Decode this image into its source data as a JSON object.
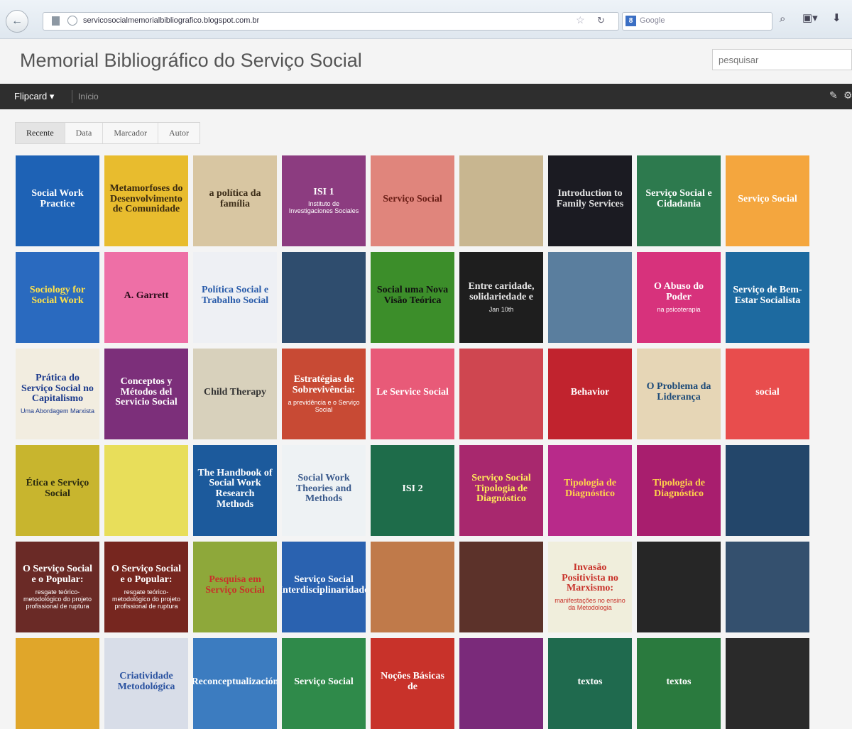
{
  "browser": {
    "url": "servicosocialmemorialbibliografico.blogspot.com.br",
    "search_engine_placeholder": "Google"
  },
  "header": {
    "title": "Memorial Bibliográfico do Serviço Social",
    "search_placeholder": "pesquisar"
  },
  "nav": {
    "view_label": "Flipcard ▾",
    "home_label": "Início"
  },
  "tabs": [
    "Recente",
    "Data",
    "Marcador",
    "Autor"
  ],
  "active_tab": "Recente",
  "posts": [
    {
      "title": "Social Work Practice",
      "subtitle": "",
      "bg": "#1e62b5",
      "fg": "#ffffff"
    },
    {
      "title": "Metamorfoses do Desenvolvimento de Comunidade",
      "subtitle": "",
      "bg": "#e8bc2e",
      "fg": "#3a2a10"
    },
    {
      "title": "a política da família",
      "subtitle": "",
      "bg": "#d8c6a2",
      "fg": "#3b2c17"
    },
    {
      "title": "ISI 1",
      "subtitle": "Instituto de Investigaciones Sociales",
      "bg": "#8c3c80",
      "fg": "#ffffff"
    },
    {
      "title": "Serviço Social",
      "subtitle": "",
      "bg": "#e0857c",
      "fg": "#6a1e16"
    },
    {
      "title": "",
      "subtitle": "",
      "bg": "#c8b690",
      "fg": "#2c2418"
    },
    {
      "title": "Introduction to Family Services",
      "subtitle": "",
      "bg": "#1b1b22",
      "fg": "#e0e0e0"
    },
    {
      "title": "Serviço Social e Cidadania",
      "subtitle": "",
      "bg": "#2d7a4e",
      "fg": "#ffffff"
    },
    {
      "title": "Serviço Social",
      "subtitle": "",
      "bg": "#f4a63e",
      "fg": "#ffffff"
    },
    {
      "title": "Sociology for Social Work",
      "subtitle": "",
      "bg": "#2a6abf",
      "fg": "#ffe24a"
    },
    {
      "title": "A. Garrett",
      "subtitle": "",
      "bg": "#ee6fa6",
      "fg": "#2a0d1a"
    },
    {
      "title": "Política Social e Trabalho Social",
      "subtitle": "",
      "bg": "#eef0f4",
      "fg": "#2a5caa"
    },
    {
      "title": "",
      "subtitle": "",
      "bg": "#2f4d6e",
      "fg": "#ffffff"
    },
    {
      "title": "Social uma Nova Visão Teórica",
      "subtitle": "",
      "bg": "#3c8e2a",
      "fg": "#111111"
    },
    {
      "title": "Entre caridade, solidariedade e",
      "subtitle": "Jan 10th",
      "bg": "#1e1e1e",
      "fg": "#e8e8e8"
    },
    {
      "title": "",
      "subtitle": "",
      "bg": "#5a7e9e",
      "fg": "#ffffff"
    },
    {
      "title": "O Abuso do Poder",
      "subtitle": "na psicoterapia",
      "bg": "#d7327c",
      "fg": "#ffffff"
    },
    {
      "title": "Serviço de Bem-Estar Socialista",
      "subtitle": "",
      "bg": "#1d6aa0",
      "fg": "#ffffff"
    },
    {
      "title": "Prática do Serviço Social no Capitalismo",
      "subtitle": "Uma Abordagem Marxista",
      "bg": "#f2ede0",
      "fg": "#1c3a8c"
    },
    {
      "title": "Conceptos y Métodos del Servicio Social",
      "subtitle": "",
      "bg": "#7c2f7a",
      "fg": "#ffffff"
    },
    {
      "title": "Child Therapy",
      "subtitle": "",
      "bg": "#d8d1bc",
      "fg": "#333333"
    },
    {
      "title": "Estratégias de Sobrevivência:",
      "subtitle": "a previdência e o Serviço Social",
      "bg": "#c84a34",
      "fg": "#ffffff"
    },
    {
      "title": "Le Service Social",
      "subtitle": "",
      "bg": "#e85a78",
      "fg": "#ffffff"
    },
    {
      "title": "",
      "subtitle": "",
      "bg": "#cf4650",
      "fg": "#ffffff"
    },
    {
      "title": "Behavior",
      "subtitle": "",
      "bg": "#c1232e",
      "fg": "#ffffff"
    },
    {
      "title": "O Problema da Liderança",
      "subtitle": "",
      "bg": "#e6d6b6",
      "fg": "#1c4a78"
    },
    {
      "title": "social",
      "subtitle": "",
      "bg": "#e84d4d",
      "fg": "#ffffff"
    },
    {
      "title": "Ética e Serviço Social",
      "subtitle": "",
      "bg": "#c8b52e",
      "fg": "#2a2a10"
    },
    {
      "title": "",
      "subtitle": "",
      "bg": "#e8de5a",
      "fg": "#2a3a10"
    },
    {
      "title": "The Handbook of Social Work Research Methods",
      "subtitle": "",
      "bg": "#1c5a9c",
      "fg": "#ffffff"
    },
    {
      "title": "Social Work Theories and Methods",
      "subtitle": "",
      "bg": "#eef2f4",
      "fg": "#3a5a8c"
    },
    {
      "title": "ISI 2",
      "subtitle": "",
      "bg": "#1e6c4a",
      "fg": "#ffffff"
    },
    {
      "title": "Serviço Social Tipologia de Diagnóstico",
      "subtitle": "",
      "bg": "#a8286e",
      "fg": "#ffe95a"
    },
    {
      "title": "Tipologia de Diagnóstico",
      "subtitle": "",
      "bg": "#b82a8a",
      "fg": "#ffd34a"
    },
    {
      "title": "Tipologia de Diagnóstico",
      "subtitle": "",
      "bg": "#a81e6e",
      "fg": "#ffd34a"
    },
    {
      "title": "",
      "subtitle": "",
      "bg": "#23466a",
      "fg": "#ffffff"
    },
    {
      "title": "O Serviço Social e o Popular:",
      "subtitle": "resgate teórico-metodológico do projeto profissional de ruptura",
      "bg": "#6a2a26",
      "fg": "#ffffff"
    },
    {
      "title": "O Serviço Social e o Popular:",
      "subtitle": "resgate teórico-metodológico do projeto profissional de ruptura",
      "bg": "#76261f",
      "fg": "#ffffff"
    },
    {
      "title": "Pesquisa em Serviço Social",
      "subtitle": "",
      "bg": "#8ea83a",
      "fg": "#c8322a"
    },
    {
      "title": "Serviço Social Interdisciplinaridade",
      "subtitle": "",
      "bg": "#2a62b0",
      "fg": "#ffffff"
    },
    {
      "title": "",
      "subtitle": "",
      "bg": "#c07a4a",
      "fg": "#ffffff"
    },
    {
      "title": "",
      "subtitle": "",
      "bg": "#5c322a",
      "fg": "#ffffff"
    },
    {
      "title": "Invasão Positivista no Marxismo:",
      "subtitle": "manifestações no ensino da Metodologia",
      "bg": "#f0eedc",
      "fg": "#c8322a"
    },
    {
      "title": "",
      "subtitle": "",
      "bg": "#262626",
      "fg": "#ffffff"
    },
    {
      "title": "",
      "subtitle": "",
      "bg": "#34506e",
      "fg": "#ffffff"
    },
    {
      "title": "",
      "subtitle": "",
      "bg": "#e0a62a",
      "fg": "#3a2a10"
    },
    {
      "title": "Criatividade Metodológica",
      "subtitle": "",
      "bg": "#d8dde8",
      "fg": "#2a52a0"
    },
    {
      "title": "Reconceptualización",
      "subtitle": "",
      "bg": "#3c7cc0",
      "fg": "#ffffff"
    },
    {
      "title": "Serviço Social",
      "subtitle": "",
      "bg": "#2f8a4a",
      "fg": "#ffffff"
    },
    {
      "title": "Noções Básicas de",
      "subtitle": "",
      "bg": "#c8322a",
      "fg": "#ffffff"
    },
    {
      "title": "",
      "subtitle": "",
      "bg": "#7a2a7a",
      "fg": "#ffffff"
    },
    {
      "title": "textos",
      "subtitle": "",
      "bg": "#1f6a4e",
      "fg": "#ffffff"
    },
    {
      "title": "textos",
      "subtitle": "",
      "bg": "#2a7a3e",
      "fg": "#ffffff"
    },
    {
      "title": "",
      "subtitle": "",
      "bg": "#2a2a2a",
      "fg": "#ffffff"
    }
  ]
}
